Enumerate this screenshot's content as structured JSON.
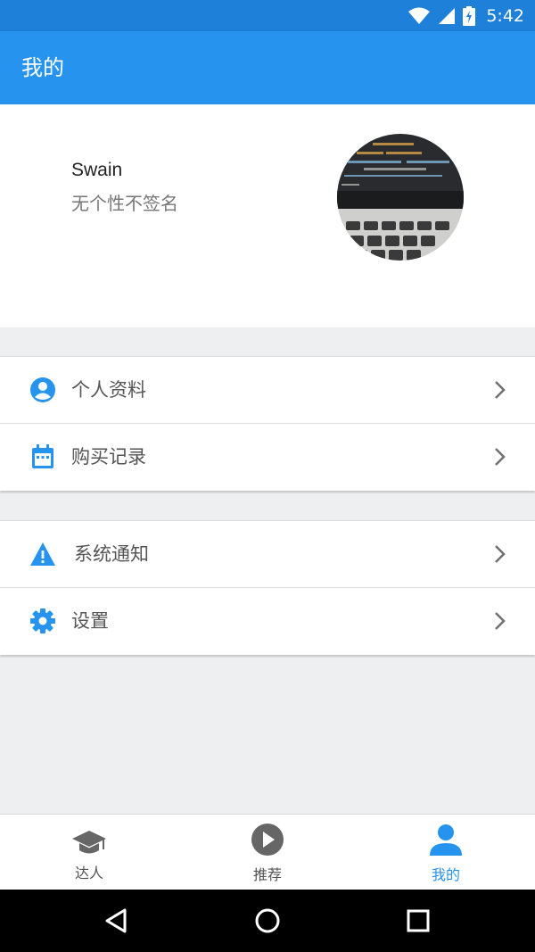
{
  "status_bar": {
    "time": "5:42",
    "icons": [
      "wifi-icon",
      "cellular-signal-icon",
      "battery-charging-icon"
    ]
  },
  "app_bar": {
    "title": "我的"
  },
  "profile": {
    "name": "Swain",
    "signature": "无个性不签名"
  },
  "menu_group_1": [
    {
      "label": "个人资料",
      "icon": "account-circle-icon"
    },
    {
      "label": "购买记录",
      "icon": "calendar-icon"
    }
  ],
  "menu_group_2": [
    {
      "label": "系统通知",
      "icon": "warning-icon"
    },
    {
      "label": "设置",
      "icon": "gear-icon"
    }
  ],
  "tabs": [
    {
      "label": "达人",
      "icon": "graduation-cap-icon",
      "active": false
    },
    {
      "label": "推荐",
      "icon": "play-circle-icon",
      "active": false
    },
    {
      "label": "我的",
      "icon": "person-icon",
      "active": true
    }
  ],
  "colors": {
    "primary": "#2693ef",
    "status_bar": "#1e80d8",
    "background": "#eeeff1",
    "inactive": "#555555"
  }
}
